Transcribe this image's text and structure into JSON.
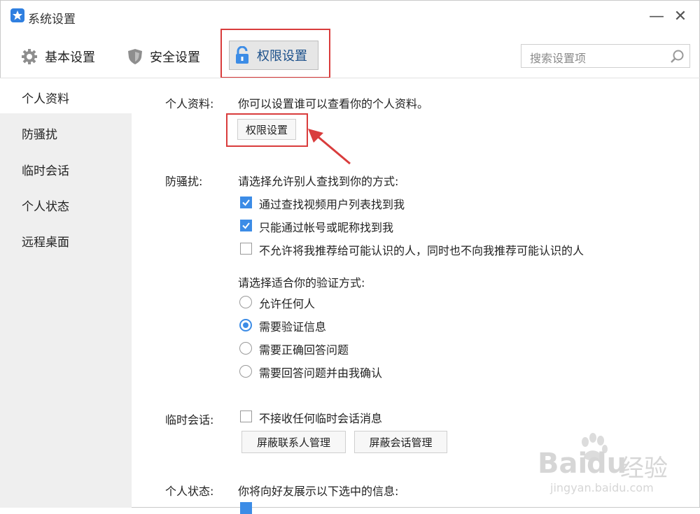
{
  "window": {
    "title": "系统设置"
  },
  "toolbar": {
    "tabs": [
      {
        "label": "基本设置",
        "icon": "gear-icon"
      },
      {
        "label": "安全设置",
        "icon": "shield-icon"
      },
      {
        "label": "权限设置",
        "icon": "lock-icon",
        "active": true
      }
    ],
    "search_placeholder": "搜索设置项"
  },
  "sidebar": {
    "items": [
      {
        "label": "个人资料",
        "active": true
      },
      {
        "label": "防骚扰"
      },
      {
        "label": "临时会话"
      },
      {
        "label": "个人状态"
      },
      {
        "label": "远程桌面"
      }
    ]
  },
  "profile": {
    "label": "个人资料:",
    "desc": "你可以设置谁可以查看你的个人资料。",
    "button": "权限设置"
  },
  "harassment": {
    "label": "防骚扰:",
    "find_prompt": "请选择允许别人查找到你的方式:",
    "options": [
      {
        "text": "通过查找视频用户列表找到我",
        "checked": true
      },
      {
        "text": "只能通过帐号或昵称找到我",
        "checked": true
      },
      {
        "text": "不允许将我推荐给可能认识的人，同时也不向我推荐可能认识的人",
        "checked": false
      }
    ],
    "verify_prompt": "请选择适合你的验证方式:",
    "verify_options": [
      {
        "text": "允许任何人",
        "selected": false
      },
      {
        "text": "需要验证信息",
        "selected": true
      },
      {
        "text": "需要正确回答问题",
        "selected": false
      },
      {
        "text": "需要回答问题并由我确认",
        "selected": false
      }
    ]
  },
  "temp_session": {
    "label": "临时会话:",
    "option": "不接收任何临时会话消息",
    "buttons": [
      "屏蔽联系人管理",
      "屏蔽会话管理"
    ]
  },
  "status": {
    "label": "个人状态:",
    "desc": "你将向好友展示以下选中的信息:"
  },
  "watermark": {
    "brand": "Bai",
    "brand2": "du",
    "cn": "经验",
    "url": "jingyan.baidu.com"
  },
  "colors": {
    "accent": "#3c8ce6",
    "highlight": "#d93c3c",
    "sidebar_bg": "#efefef"
  }
}
